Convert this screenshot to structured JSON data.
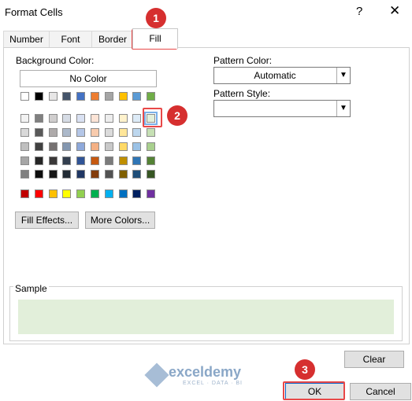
{
  "window": {
    "title": "Format Cells",
    "help_label": "?",
    "close_label": "✕"
  },
  "tabs": [
    {
      "label": "Number"
    },
    {
      "label": "Font"
    },
    {
      "label": "Border"
    },
    {
      "label": "Fill",
      "selected": true
    }
  ],
  "background": {
    "label": "Background Color:",
    "no_color_label": "No Color",
    "fill_effects_label": "Fill Effects...",
    "more_colors_label": "More Colors...",
    "selected_color": "#e2efda",
    "theme_row": [
      "#ffffff",
      "#000000",
      "#e7e6e6",
      "#44546a",
      "#4472c4",
      "#ed7d31",
      "#a5a5a5",
      "#ffc000",
      "#5b9bd5",
      "#70ad47"
    ],
    "tint_rows": [
      [
        "#f2f2f2",
        "#808080",
        "#d0cece",
        "#d6dce5",
        "#d9e1f2",
        "#fce4d6",
        "#ededed",
        "#fff2cc",
        "#ddebf7",
        "#e2efda"
      ],
      [
        "#d9d9d9",
        "#595959",
        "#aeaaaa",
        "#acb9ca",
        "#b4c6e7",
        "#f8cbad",
        "#dbdbdb",
        "#ffe699",
        "#bdd7ee",
        "#c6e0b4"
      ],
      [
        "#bfbfbf",
        "#404040",
        "#757171",
        "#8497b0",
        "#8ea9db",
        "#f4b084",
        "#c9c9c9",
        "#ffd966",
        "#9bc2e6",
        "#a9d08e"
      ],
      [
        "#a6a6a6",
        "#262626",
        "#3a3838",
        "#333f4f",
        "#305496",
        "#c65911",
        "#7b7b7b",
        "#bf8f00",
        "#2f75b5",
        "#548235"
      ],
      [
        "#808080",
        "#0d0d0d",
        "#161616",
        "#222b35",
        "#203764",
        "#833c0c",
        "#525252",
        "#806000",
        "#1f4e78",
        "#375623"
      ]
    ],
    "standard_row": [
      "#c00000",
      "#ff0000",
      "#ffc000",
      "#ffff00",
      "#92d050",
      "#00b050",
      "#00b0f0",
      "#0070c0",
      "#002060",
      "#7030a0"
    ]
  },
  "pattern": {
    "color_label": "Pattern Color:",
    "color_value": "Automatic",
    "style_label": "Pattern Style:",
    "style_value": ""
  },
  "sample": {
    "label": "Sample",
    "color": "#e2efda"
  },
  "buttons": {
    "clear": "Clear",
    "ok": "OK",
    "cancel": "Cancel"
  },
  "annotations": [
    "1",
    "2",
    "3"
  ],
  "watermark": {
    "brand": "exceldemy",
    "tagline": "EXCEL · DATA · BI"
  }
}
